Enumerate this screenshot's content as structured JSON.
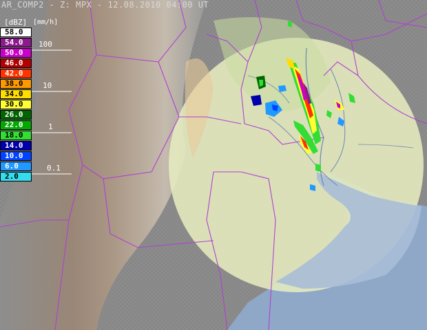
{
  "title": "AR_COMP2 - Z: MPX - 12.08.2010 04:00 UT",
  "units_label": "[mm/h]",
  "dbz_label": "[dBZ]",
  "legend": [
    {
      "value": "58.0",
      "color": "#ffffff",
      "text": "#000000"
    },
    {
      "value": "54.0",
      "color": "#8c1a8c",
      "text": "#ffffff"
    },
    {
      "value": "50.0",
      "color": "#cc00cc",
      "text": "#ffffff"
    },
    {
      "value": "46.0",
      "color": "#b30000",
      "text": "#ffffff"
    },
    {
      "value": "42.0",
      "color": "#ff3300",
      "text": "#ffffff"
    },
    {
      "value": "38.0",
      "color": "#ff9900",
      "text": "#000000"
    },
    {
      "value": "34.0",
      "color": "#ffdd00",
      "text": "#000000"
    },
    {
      "value": "30.0",
      "color": "#ffff33",
      "text": "#000000"
    },
    {
      "value": "26.0",
      "color": "#006600",
      "text": "#ffffff"
    },
    {
      "value": "22.0",
      "color": "#00aa00",
      "text": "#ffffff"
    },
    {
      "value": "18.0",
      "color": "#33dd33",
      "text": "#000000"
    },
    {
      "value": "14.0",
      "color": "#0000aa",
      "text": "#ffffff"
    },
    {
      "value": "10.0",
      "color": "#0044ff",
      "text": "#ffffff"
    },
    {
      "value": "6.0",
      "color": "#2299ff",
      "text": "#ffffff"
    },
    {
      "value": "2.0",
      "color": "#33ddee",
      "text": "#000000"
    }
  ],
  "rain_rates": [
    "100",
    "10",
    "1",
    "0.1"
  ],
  "colors": {
    "background": "#8a8a8a",
    "radar_coverage": "#e6ecbf",
    "sea": "#8fa8c8",
    "borders": "#b040d0",
    "mountains": "#9a7f6a"
  }
}
